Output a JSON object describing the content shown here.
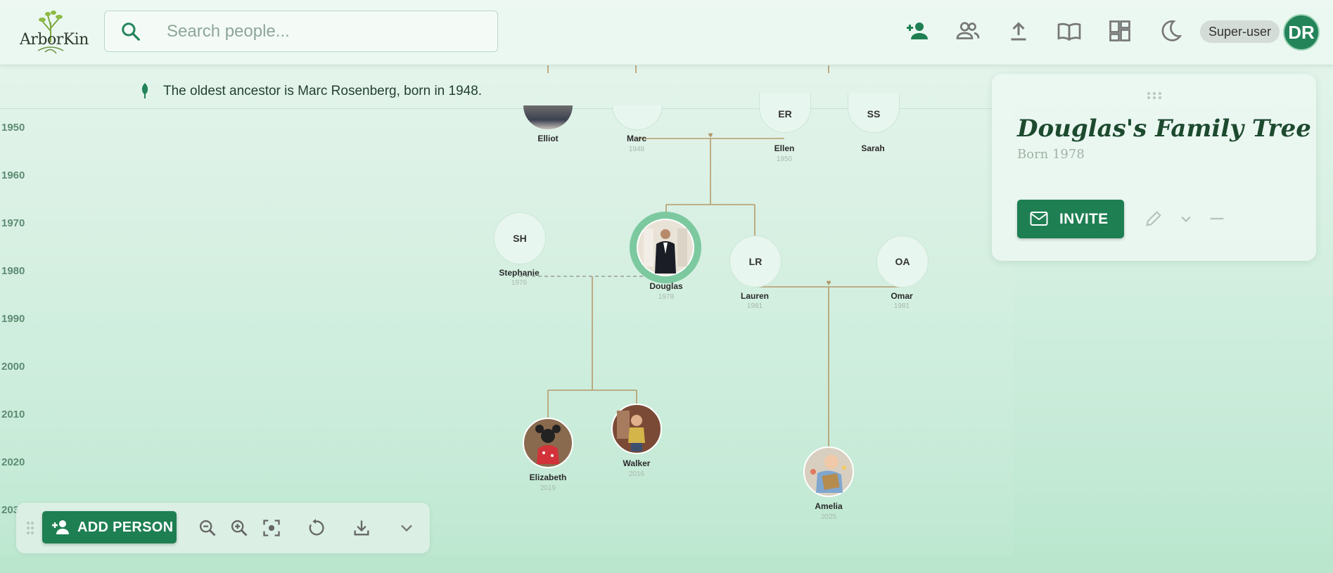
{
  "app": {
    "logo_text": "ArborKin"
  },
  "search": {
    "placeholder": "Search people..."
  },
  "header": {
    "icons": [
      "add-person-icon",
      "people-icon",
      "upload-icon",
      "book-icon",
      "dashboard-icon",
      "dark-mode-icon"
    ],
    "role": "Super-user",
    "user_initials": "DR"
  },
  "banner": {
    "text": "The oldest ancestor is Marc Rosenberg, born in 1948."
  },
  "timeline": {
    "years": [
      "1950",
      "1960",
      "1970",
      "1980",
      "1990",
      "2000",
      "2010",
      "2020",
      "203"
    ]
  },
  "people": {
    "elliot": {
      "name": "Elliot",
      "year": ""
    },
    "marc": {
      "name": "Marc",
      "year": "1948"
    },
    "ellen": {
      "initials": "ER",
      "name": "Ellen",
      "year": "1950"
    },
    "sarah": {
      "initials": "SS",
      "name": "Sarah",
      "year": ""
    },
    "stephanie": {
      "initials": "SH",
      "name": "Stephanie",
      "year": "1976"
    },
    "douglas": {
      "name": "Douglas",
      "year": "1978"
    },
    "lauren": {
      "initials": "LR",
      "name": "Lauren",
      "year": "1981"
    },
    "omar": {
      "initials": "OA",
      "name": "Omar",
      "year": "1981"
    },
    "elizabeth": {
      "name": "Elizabeth",
      "year": "2019"
    },
    "walker": {
      "name": "Walker",
      "year": "2016"
    },
    "amelia": {
      "name": "Amelia",
      "year": "2025"
    }
  },
  "card": {
    "title": "Douglas's Family Tree",
    "subtitle": "Born 1978",
    "invite_label": "INVITE"
  },
  "toolbar": {
    "add_person_label": "ADD PERSON",
    "icons": [
      "zoom-out-icon",
      "zoom-in-icon",
      "center-focus-icon",
      "reset-icon",
      "download-icon",
      "chevron-down-icon"
    ]
  },
  "colors": {
    "accent": "#1e7f52",
    "line": "#b59a6a",
    "selected_ring": "#7cc9a0"
  }
}
